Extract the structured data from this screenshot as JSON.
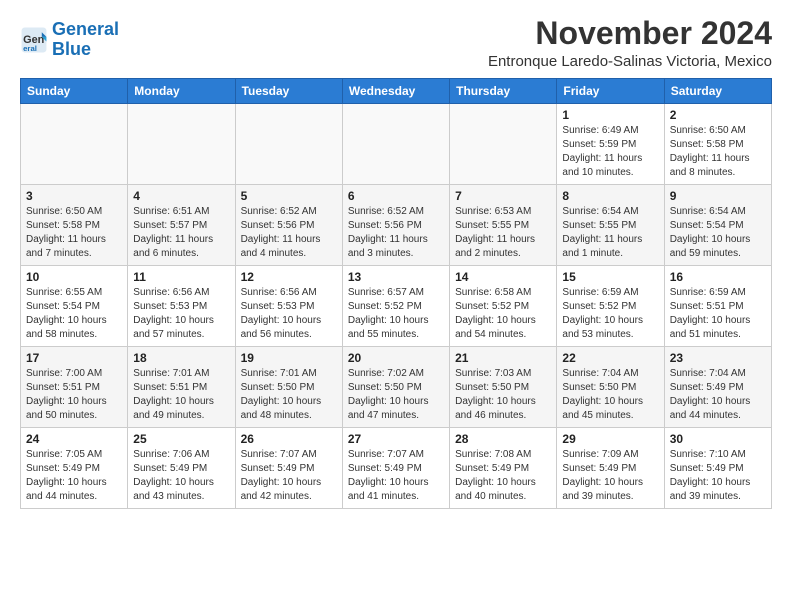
{
  "logo": {
    "text_general": "General",
    "text_blue": "Blue"
  },
  "header": {
    "title": "November 2024",
    "subtitle": "Entronque Laredo-Salinas Victoria, Mexico"
  },
  "weekdays": [
    "Sunday",
    "Monday",
    "Tuesday",
    "Wednesday",
    "Thursday",
    "Friday",
    "Saturday"
  ],
  "weeks": [
    {
      "days": [
        {
          "date": "",
          "info": ""
        },
        {
          "date": "",
          "info": ""
        },
        {
          "date": "",
          "info": ""
        },
        {
          "date": "",
          "info": ""
        },
        {
          "date": "",
          "info": ""
        },
        {
          "date": "1",
          "info": "Sunrise: 6:49 AM\nSunset: 5:59 PM\nDaylight: 11 hours\nand 10 minutes."
        },
        {
          "date": "2",
          "info": "Sunrise: 6:50 AM\nSunset: 5:58 PM\nDaylight: 11 hours\nand 8 minutes."
        }
      ]
    },
    {
      "days": [
        {
          "date": "3",
          "info": "Sunrise: 6:50 AM\nSunset: 5:58 PM\nDaylight: 11 hours\nand 7 minutes."
        },
        {
          "date": "4",
          "info": "Sunrise: 6:51 AM\nSunset: 5:57 PM\nDaylight: 11 hours\nand 6 minutes."
        },
        {
          "date": "5",
          "info": "Sunrise: 6:52 AM\nSunset: 5:56 PM\nDaylight: 11 hours\nand 4 minutes."
        },
        {
          "date": "6",
          "info": "Sunrise: 6:52 AM\nSunset: 5:56 PM\nDaylight: 11 hours\nand 3 minutes."
        },
        {
          "date": "7",
          "info": "Sunrise: 6:53 AM\nSunset: 5:55 PM\nDaylight: 11 hours\nand 2 minutes."
        },
        {
          "date": "8",
          "info": "Sunrise: 6:54 AM\nSunset: 5:55 PM\nDaylight: 11 hours\nand 1 minute."
        },
        {
          "date": "9",
          "info": "Sunrise: 6:54 AM\nSunset: 5:54 PM\nDaylight: 10 hours\nand 59 minutes."
        }
      ]
    },
    {
      "days": [
        {
          "date": "10",
          "info": "Sunrise: 6:55 AM\nSunset: 5:54 PM\nDaylight: 10 hours\nand 58 minutes."
        },
        {
          "date": "11",
          "info": "Sunrise: 6:56 AM\nSunset: 5:53 PM\nDaylight: 10 hours\nand 57 minutes."
        },
        {
          "date": "12",
          "info": "Sunrise: 6:56 AM\nSunset: 5:53 PM\nDaylight: 10 hours\nand 56 minutes."
        },
        {
          "date": "13",
          "info": "Sunrise: 6:57 AM\nSunset: 5:52 PM\nDaylight: 10 hours\nand 55 minutes."
        },
        {
          "date": "14",
          "info": "Sunrise: 6:58 AM\nSunset: 5:52 PM\nDaylight: 10 hours\nand 54 minutes."
        },
        {
          "date": "15",
          "info": "Sunrise: 6:59 AM\nSunset: 5:52 PM\nDaylight: 10 hours\nand 53 minutes."
        },
        {
          "date": "16",
          "info": "Sunrise: 6:59 AM\nSunset: 5:51 PM\nDaylight: 10 hours\nand 51 minutes."
        }
      ]
    },
    {
      "days": [
        {
          "date": "17",
          "info": "Sunrise: 7:00 AM\nSunset: 5:51 PM\nDaylight: 10 hours\nand 50 minutes."
        },
        {
          "date": "18",
          "info": "Sunrise: 7:01 AM\nSunset: 5:51 PM\nDaylight: 10 hours\nand 49 minutes."
        },
        {
          "date": "19",
          "info": "Sunrise: 7:01 AM\nSunset: 5:50 PM\nDaylight: 10 hours\nand 48 minutes."
        },
        {
          "date": "20",
          "info": "Sunrise: 7:02 AM\nSunset: 5:50 PM\nDaylight: 10 hours\nand 47 minutes."
        },
        {
          "date": "21",
          "info": "Sunrise: 7:03 AM\nSunset: 5:50 PM\nDaylight: 10 hours\nand 46 minutes."
        },
        {
          "date": "22",
          "info": "Sunrise: 7:04 AM\nSunset: 5:50 PM\nDaylight: 10 hours\nand 45 minutes."
        },
        {
          "date": "23",
          "info": "Sunrise: 7:04 AM\nSunset: 5:49 PM\nDaylight: 10 hours\nand 44 minutes."
        }
      ]
    },
    {
      "days": [
        {
          "date": "24",
          "info": "Sunrise: 7:05 AM\nSunset: 5:49 PM\nDaylight: 10 hours\nand 44 minutes."
        },
        {
          "date": "25",
          "info": "Sunrise: 7:06 AM\nSunset: 5:49 PM\nDaylight: 10 hours\nand 43 minutes."
        },
        {
          "date": "26",
          "info": "Sunrise: 7:07 AM\nSunset: 5:49 PM\nDaylight: 10 hours\nand 42 minutes."
        },
        {
          "date": "27",
          "info": "Sunrise: 7:07 AM\nSunset: 5:49 PM\nDaylight: 10 hours\nand 41 minutes."
        },
        {
          "date": "28",
          "info": "Sunrise: 7:08 AM\nSunset: 5:49 PM\nDaylight: 10 hours\nand 40 minutes."
        },
        {
          "date": "29",
          "info": "Sunrise: 7:09 AM\nSunset: 5:49 PM\nDaylight: 10 hours\nand 39 minutes."
        },
        {
          "date": "30",
          "info": "Sunrise: 7:10 AM\nSunset: 5:49 PM\nDaylight: 10 hours\nand 39 minutes."
        }
      ]
    }
  ]
}
